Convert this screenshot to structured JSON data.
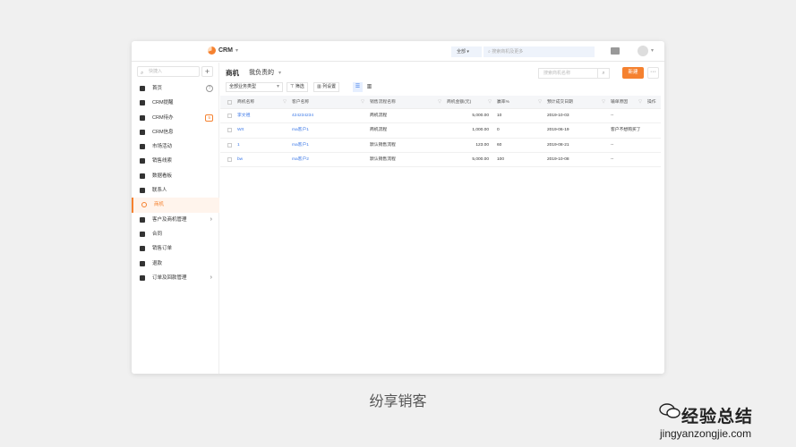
{
  "topbar": {
    "app_name": "CRM",
    "scope": "全部",
    "search_placeholder": "搜索商机及更多"
  },
  "sidebar": {
    "search_placeholder": "快捷入",
    "items": [
      {
        "label": "首页",
        "icon": "home-icon"
      },
      {
        "label": "CRM提醒",
        "icon": "bell-icon"
      },
      {
        "label": "CRM待办",
        "icon": "todo-icon",
        "badge": "5"
      },
      {
        "label": "CRM信息",
        "icon": "pie-icon"
      },
      {
        "label": "市场活动",
        "icon": "flag-icon"
      },
      {
        "label": "销售线索",
        "icon": "swap-icon"
      },
      {
        "label": "数据看板",
        "icon": "monitor-icon"
      },
      {
        "label": "联系人",
        "icon": "user-icon"
      },
      {
        "label": "商机",
        "icon": "target-icon",
        "active": true
      },
      {
        "label": "客户及商机管理",
        "icon": "folder-icon",
        "arrow": true
      },
      {
        "label": "合同",
        "icon": "doc-icon"
      },
      {
        "label": "销售订单",
        "icon": "order-icon"
      },
      {
        "label": "退款",
        "icon": "refund-icon"
      },
      {
        "label": "订单及回款管理",
        "icon": "folder-icon",
        "arrow": true
      }
    ]
  },
  "main": {
    "title": "商机",
    "view": "我负责的",
    "search_placeholder": "搜索商机名称",
    "new_button": "新建",
    "more_button": "···",
    "biz_type": "全部业务类型",
    "filter_button": "筛选",
    "column_settings": "列设置"
  },
  "table": {
    "columns": [
      "商机名称",
      "客户名称",
      "销售流程名称",
      "商机金额(元)",
      "赢率%",
      "预计成交日期",
      "输单原因",
      "操作"
    ],
    "rows": [
      {
        "name": "李文祖",
        "customer": "424234234",
        "process": "商机流程",
        "amount": "5,000.00",
        "rate": "10",
        "date": "2019-10-03",
        "reason": "--"
      },
      {
        "name": "Wrt",
        "customer": "ma客户1",
        "process": "商机流程",
        "amount": "1,000.00",
        "rate": "0",
        "date": "2019-06-19",
        "reason": "客户不想购买了"
      },
      {
        "name": "1",
        "customer": "ma客户1",
        "process": "默认销售流程",
        "amount": "123.00",
        "rate": "60",
        "date": "2019-08-21",
        "reason": "--"
      },
      {
        "name": "bw",
        "customer": "ma客户2",
        "process": "默认销售流程",
        "amount": "5,000.00",
        "rate": "100",
        "date": "2019-10-08",
        "reason": "--"
      }
    ]
  },
  "caption": "纷享销客",
  "watermark": {
    "text": "经验总结",
    "url": "jingyanzongjie.com"
  }
}
